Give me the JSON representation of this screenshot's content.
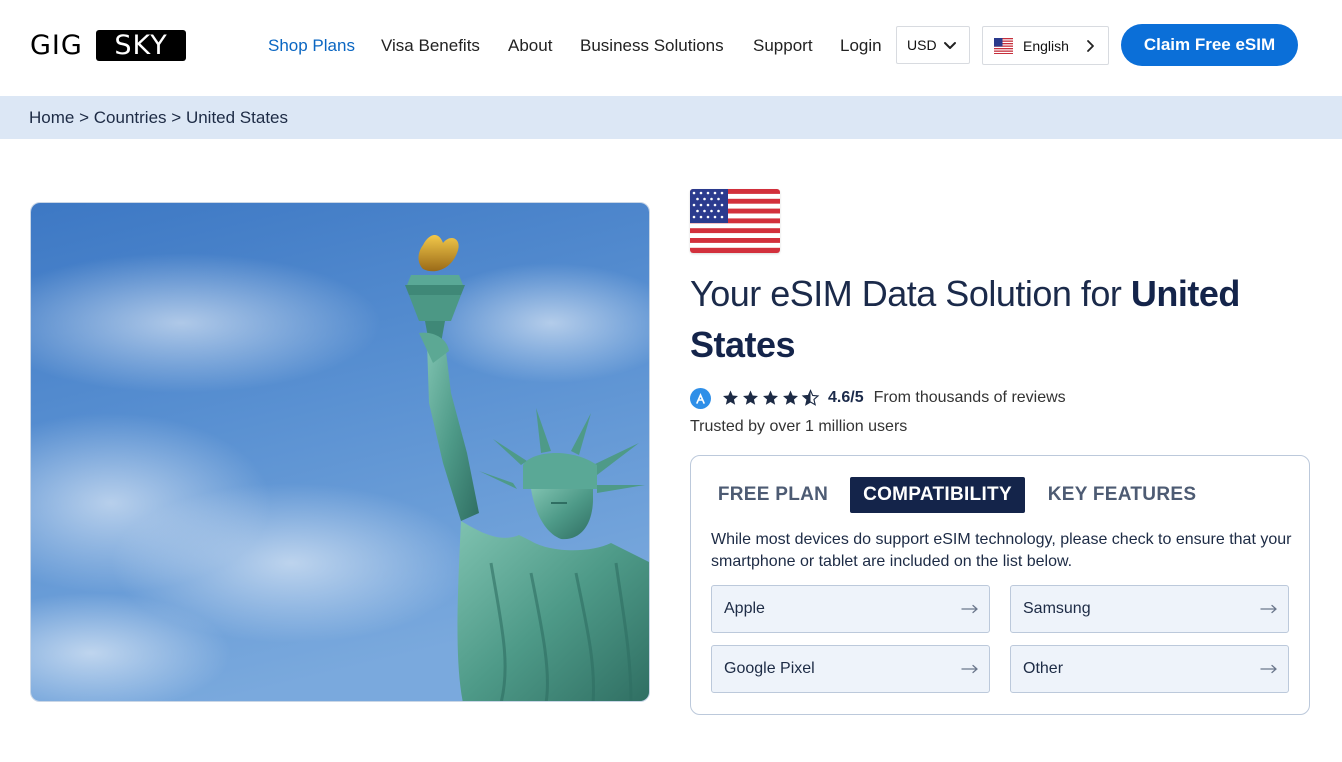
{
  "header": {
    "logo_left": "GIG",
    "logo_right": "SKY",
    "nav": [
      {
        "label": "Shop Plans",
        "active": true
      },
      {
        "label": "Visa Benefits",
        "active": false
      },
      {
        "label": "About",
        "active": false
      },
      {
        "label": "Business Solutions",
        "active": false
      },
      {
        "label": "Support",
        "active": false
      },
      {
        "label": "Login",
        "active": false
      }
    ],
    "currency": "USD",
    "language": "English",
    "cta": "Claim Free eSIM"
  },
  "breadcrumb": {
    "items": [
      "Home",
      "Countries",
      "United States"
    ],
    "separator": ">"
  },
  "hero": {
    "title_prefix": "Your eSIM Data Solution for ",
    "title_country": "United States"
  },
  "rating": {
    "stars": 4.6,
    "score": "4.6/5",
    "reviews": "From thousands of reviews",
    "trusted": "Trusted by over 1 million users"
  },
  "tabs": {
    "items": [
      {
        "label": "FREE PLAN",
        "active": false
      },
      {
        "label": "COMPATIBILITY",
        "active": true
      },
      {
        "label": "KEY FEATURES",
        "active": false
      }
    ],
    "text": "While most devices do support eSIM technology, please check to ensure that your smartphone or tablet are included on the list below.",
    "devices": [
      "Apple",
      "Samsung",
      "Google Pixel",
      "Other"
    ]
  },
  "colors": {
    "accent": "#0b6fd8",
    "navy": "#14244a",
    "breadcrumb_bg": "#dce7f5"
  },
  "icons": {
    "currency_chevron": "chevron-down-icon",
    "language_chevron": "chevron-right-icon",
    "appstore": "app-store-icon",
    "device_arrow": "arrow-right-icon"
  }
}
